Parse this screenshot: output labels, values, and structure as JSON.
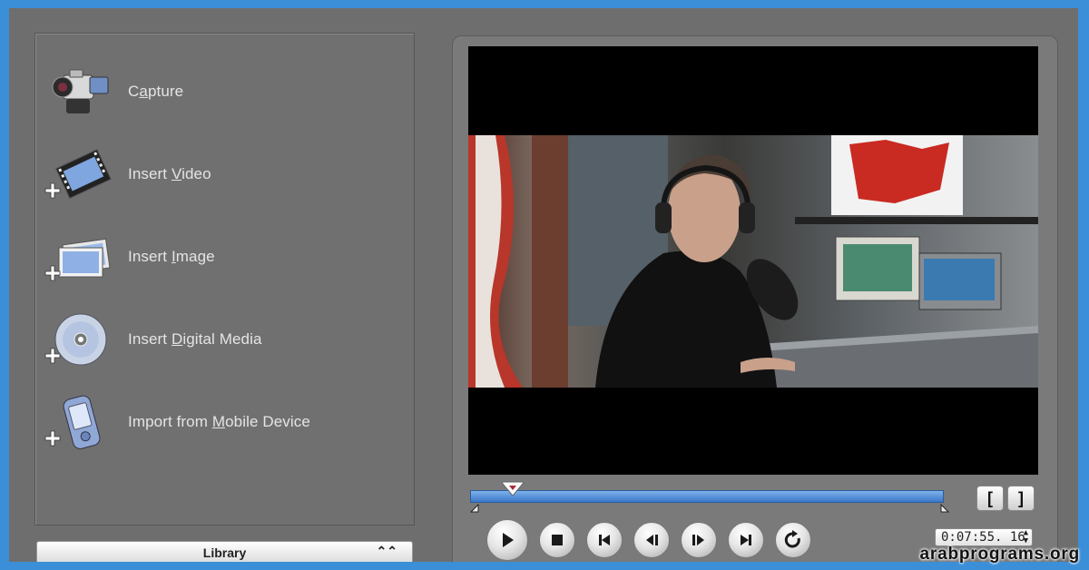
{
  "library_panel": {
    "items": [
      {
        "prefix": "C",
        "mnemonic": "a",
        "suffix": "pture",
        "icon": "camcorder-icon"
      },
      {
        "prefix": "Insert ",
        "mnemonic": "V",
        "suffix": "ideo",
        "icon": "film-strip-icon"
      },
      {
        "prefix": "Insert ",
        "mnemonic": "I",
        "suffix": "mage",
        "icon": "photo-icon"
      },
      {
        "prefix": "Insert ",
        "mnemonic": "D",
        "suffix": "igital Media",
        "icon": "disc-icon"
      },
      {
        "prefix": "Import from ",
        "mnemonic": "M",
        "suffix": "obile Device",
        "icon": "mobile-device-icon"
      }
    ],
    "library_label": "Library",
    "collapse_icon": "double-chevron-up-icon"
  },
  "player": {
    "timecode": "0:07:55. 16",
    "trim_in_label": "[",
    "trim_out_label": "]",
    "controls": [
      "play-icon",
      "stop-icon",
      "home-icon",
      "previous-frame-icon",
      "next-frame-icon",
      "end-icon",
      "repeat-icon"
    ],
    "scrub_position": 0.09
  },
  "watermark": "arabprograms.org",
  "colors": {
    "accent_blue": "#3a78c9",
    "frame_blue": "#3b8fd9",
    "panel_gray": "#707070"
  }
}
